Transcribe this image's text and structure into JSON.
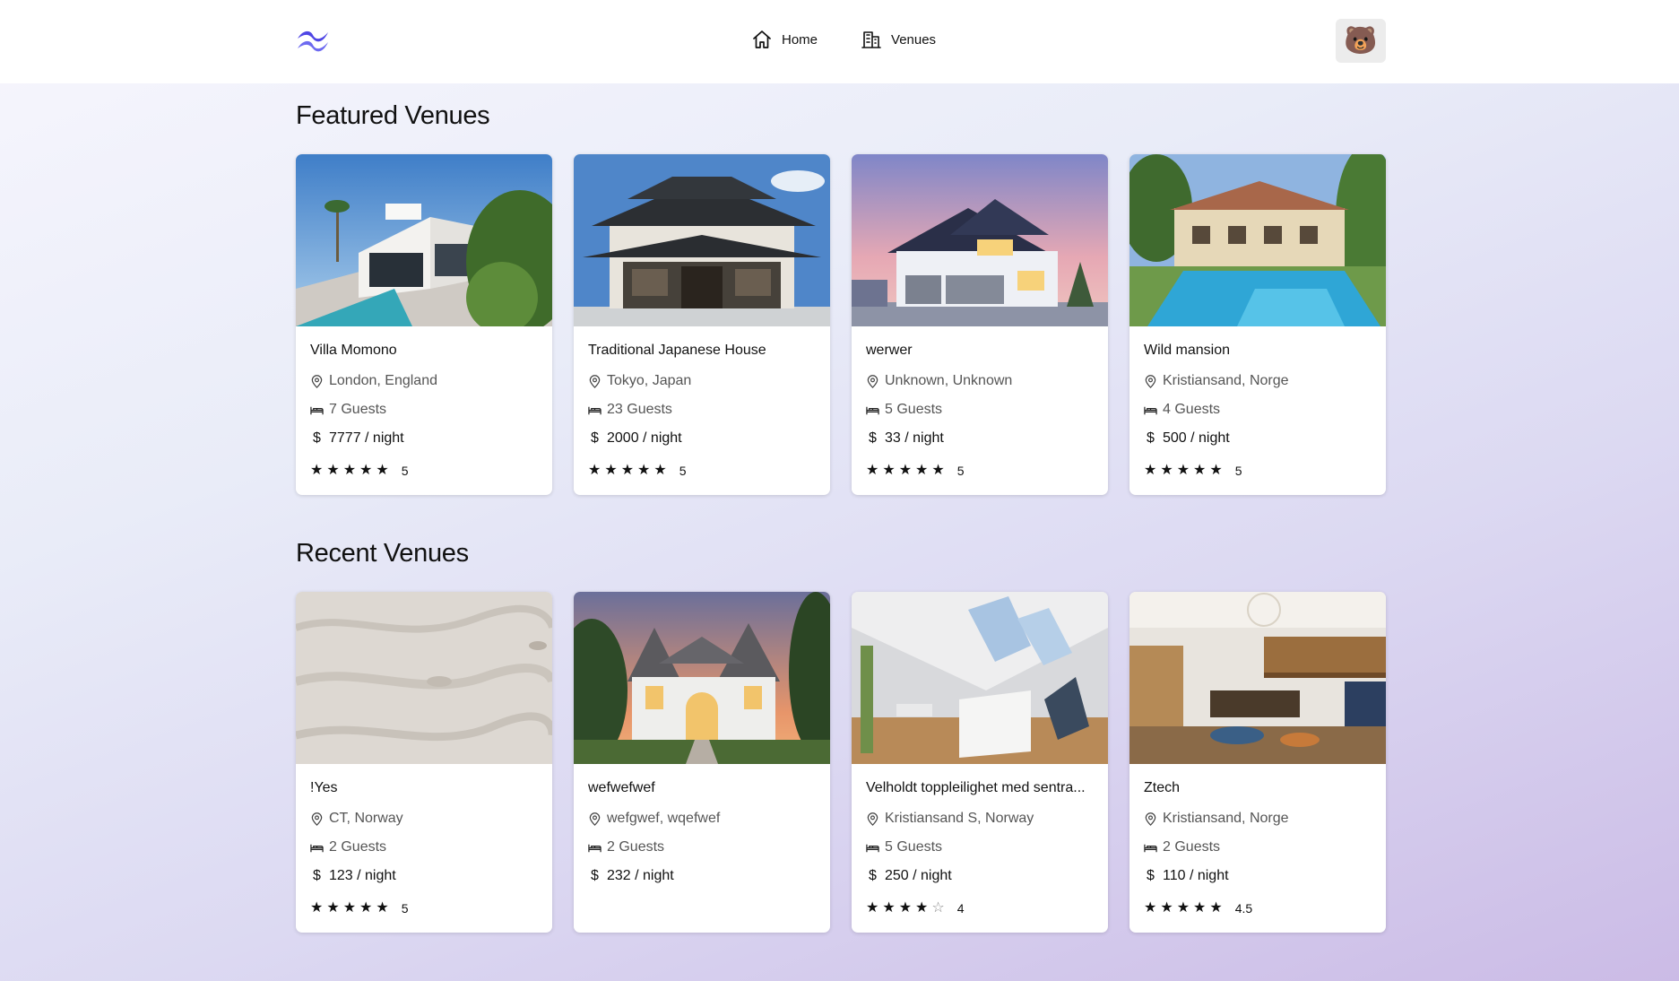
{
  "nav": {
    "home_label": "Home",
    "venues_label": "Venues"
  },
  "avatar": {
    "emoji": "🐻"
  },
  "colors": {
    "brand": "#4f46e5",
    "brand_light": "#6d6af0"
  },
  "featured": {
    "title": "Featured Venues",
    "venues": [
      {
        "name": "Villa Momono",
        "location": "London, England",
        "guests": "7 Guests",
        "price": "7777 / night",
        "rating": 5,
        "rating_label": "5"
      },
      {
        "name": "Traditional Japanese House",
        "location": "Tokyo, Japan",
        "guests": "23 Guests",
        "price": "2000 / night",
        "rating": 5,
        "rating_label": "5"
      },
      {
        "name": "werwer",
        "location": "Unknown, Unknown",
        "guests": "5 Guests",
        "price": "33 / night",
        "rating": 5,
        "rating_label": "5"
      },
      {
        "name": "Wild mansion",
        "location": "Kristiansand, Norge",
        "guests": "4 Guests",
        "price": "500 / night",
        "rating": 5,
        "rating_label": "5"
      }
    ]
  },
  "recent": {
    "title": "Recent Venues",
    "venues": [
      {
        "name": "!Yes",
        "location": "CT, Norway",
        "guests": "2 Guests",
        "price": "123 / night",
        "rating": 5,
        "rating_label": "5"
      },
      {
        "name": "wefwefwef",
        "location": "wefgwef, wqefwef",
        "guests": "2 Guests",
        "price": "232 / night",
        "rating": null,
        "rating_label": ""
      },
      {
        "name": "Velholdt toppleilighet med sentra...",
        "location": "Kristiansand S, Norway",
        "guests": "5 Guests",
        "price": "250 / night",
        "rating": 4,
        "rating_label": "4"
      },
      {
        "name": "Ztech",
        "location": "Kristiansand, Norge",
        "guests": "2 Guests",
        "price": "110 / night",
        "rating": 4.5,
        "rating_label": "4.5"
      }
    ]
  }
}
